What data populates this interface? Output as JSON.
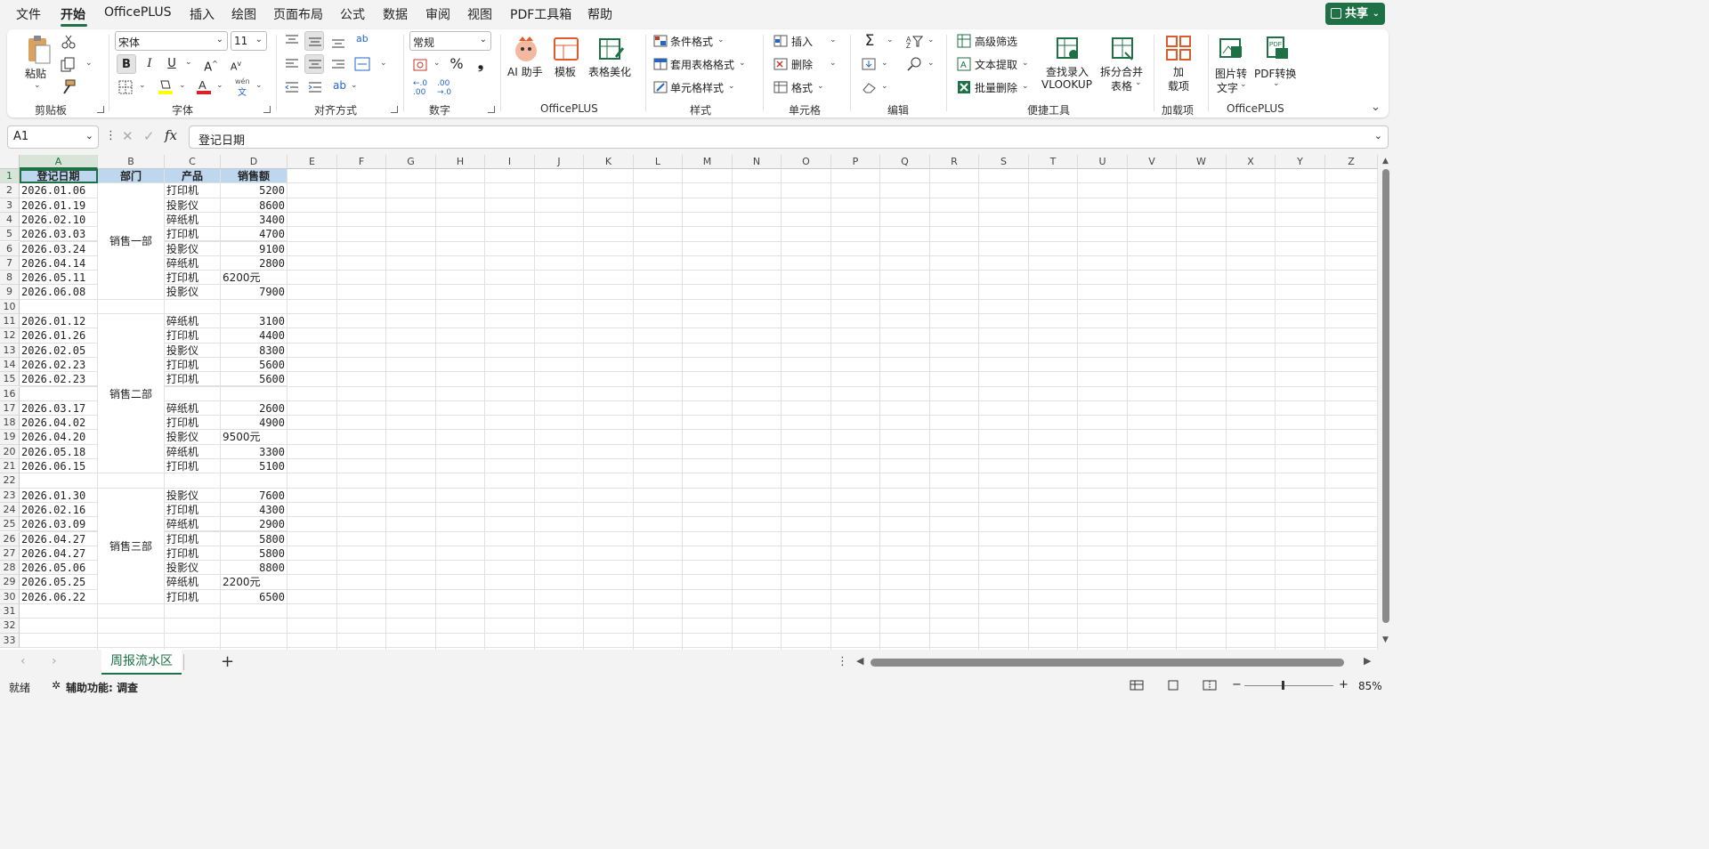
{
  "menubar": {
    "items": [
      "文件",
      "开始",
      "OfficePLUS",
      "插入",
      "绘图",
      "页面布局",
      "公式",
      "数据",
      "审阅",
      "视图",
      "PDF工具箱",
      "帮助"
    ],
    "active": "开始",
    "share_label": "共享"
  },
  "ribbon": {
    "clipboard": {
      "label": "剪贴板",
      "paste": "粘贴"
    },
    "font": {
      "label": "字体",
      "font_name": "宋体",
      "font_size": "11",
      "phonetic": "wén"
    },
    "alignment": {
      "label": "对齐方式"
    },
    "number": {
      "label": "数字",
      "format": "常规"
    },
    "officeplus": {
      "label": "OfficePLUS",
      "ai": "AI 助手",
      "template": "模板",
      "beautify": "表格美化"
    },
    "styles": {
      "label": "样式",
      "conditional": "条件格式",
      "table_format": "套用表格格式",
      "cell_styles": "单元格样式"
    },
    "cells": {
      "label": "单元格",
      "insert": "插入",
      "delete": "删除",
      "format": "格式"
    },
    "editing": {
      "label": "编辑"
    },
    "tools": {
      "label": "便捷工具",
      "adv_filter": "高级筛选",
      "text_extract": "文本提取",
      "batch_delete": "批量删除",
      "vlookup_1": "查找录入",
      "vlookup_2": "VLOOKUP",
      "split_1": "拆分合并",
      "split_2": "表格"
    },
    "addins": {
      "label": "加载项",
      "btn_1": "加",
      "btn_2": "载项"
    },
    "officeplus2": {
      "label": "OfficePLUS",
      "img_1": "图片转",
      "img_2": "文字",
      "pdf": "PDF转换"
    }
  },
  "formula_bar": {
    "name_box": "A1",
    "formula": "登记日期"
  },
  "columns": [
    "A",
    "B",
    "C",
    "D",
    "E",
    "F",
    "G",
    "H",
    "I",
    "J",
    "K",
    "L",
    "M",
    "N",
    "O",
    "P",
    "Q",
    "R",
    "S",
    "T",
    "U",
    "V",
    "W",
    "X",
    "Y",
    "Z"
  ],
  "rows": [
    "1",
    "2",
    "3",
    "4",
    "5",
    "6",
    "7",
    "8",
    "9",
    "10",
    "11",
    "12",
    "13",
    "14",
    "15",
    "16",
    "17",
    "18",
    "19",
    "20",
    "21",
    "22",
    "23",
    "24",
    "25",
    "26",
    "27",
    "28",
    "29",
    "30",
    "31",
    "32",
    "33"
  ],
  "table": {
    "headers": [
      "登记日期",
      "部门",
      "产品",
      "销售额"
    ],
    "departments": [
      "销售一部",
      "销售二部",
      "销售三部"
    ],
    "rows": [
      {
        "r": 2,
        "date": "2026.01.06",
        "product": "打印机",
        "sales": "5200"
      },
      {
        "r": 3,
        "date": "2026.01.19",
        "product": "投影仪",
        "sales": "8600"
      },
      {
        "r": 4,
        "date": "2026.02.10",
        "product": "碎纸机",
        "sales": "3400"
      },
      {
        "r": 5,
        "date": "2026.03.03",
        "product": "打印机",
        "sales": "4700"
      },
      {
        "r": 6,
        "date": "2026.03.24",
        "product": "投影仪",
        "sales": "9100"
      },
      {
        "r": 7,
        "date": "2026.04.14",
        "product": "碎纸机",
        "sales": "2800"
      },
      {
        "r": 8,
        "date": "2026.05.11",
        "product": "打印机",
        "sales": "6200元"
      },
      {
        "r": 9,
        "date": "2026.06.08",
        "product": "投影仪",
        "sales": "7900"
      },
      {
        "r": 11,
        "date": "2026.01.12",
        "product": "碎纸机",
        "sales": "3100"
      },
      {
        "r": 12,
        "date": "2026.01.26",
        "product": "打印机",
        "sales": "4400"
      },
      {
        "r": 13,
        "date": "2026.02.05",
        "product": "投影仪",
        "sales": "8300"
      },
      {
        "r": 14,
        "date": "2026.02.23",
        "product": "打印机",
        "sales": "5600"
      },
      {
        "r": 15,
        "date": "2026.02.23",
        "product": "打印机",
        "sales": "5600"
      },
      {
        "r": 17,
        "date": "2026.03.17",
        "product": "碎纸机",
        "sales": "2600"
      },
      {
        "r": 18,
        "date": "2026.04.02",
        "product": "打印机",
        "sales": "4900"
      },
      {
        "r": 19,
        "date": "2026.04.20",
        "product": "投影仪",
        "sales": "9500元"
      },
      {
        "r": 20,
        "date": "2026.05.18",
        "product": "碎纸机",
        "sales": "3300"
      },
      {
        "r": 21,
        "date": "2026.06.15",
        "product": "打印机",
        "sales": "5100"
      },
      {
        "r": 23,
        "date": "2026.01.30",
        "product": "投影仪",
        "sales": "7600"
      },
      {
        "r": 24,
        "date": "2026.02.16",
        "product": "打印机",
        "sales": "4300"
      },
      {
        "r": 25,
        "date": "2026.03.09",
        "product": "碎纸机",
        "sales": "2900"
      },
      {
        "r": 26,
        "date": "2026.04.27",
        "product": "打印机",
        "sales": "5800"
      },
      {
        "r": 27,
        "date": "2026.04.27",
        "product": "打印机",
        "sales": "5800"
      },
      {
        "r": 28,
        "date": "2026.05.06",
        "product": "投影仪",
        "sales": "8800"
      },
      {
        "r": 29,
        "date": "2026.05.25",
        "product": "碎纸机",
        "sales": "2200元"
      },
      {
        "r": 30,
        "date": "2026.06.22",
        "product": "打印机",
        "sales": "6500"
      }
    ]
  },
  "sheet_tabs": {
    "active": "周报流水区"
  },
  "status": {
    "ready": "就绪",
    "accessibility": "辅助功能: 调查",
    "zoom": "85%"
  }
}
